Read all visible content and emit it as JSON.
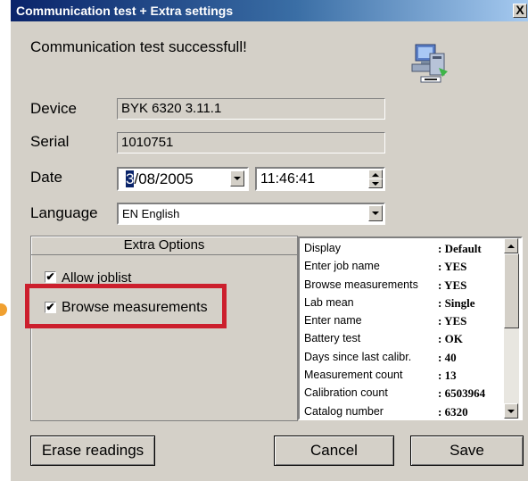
{
  "window": {
    "title": "Communication test + Extra settings",
    "close_label": "X"
  },
  "status_message": "Communication test successfull!",
  "fields": {
    "device": {
      "label": "Device",
      "value": "BYK 6320 3.11.1"
    },
    "serial": {
      "label": "Serial",
      "value": "1010751"
    },
    "date": {
      "label": "Date",
      "day_selected": "3",
      "date_rest": "/08/2005",
      "time": "11:46:41"
    },
    "language": {
      "label": "Language",
      "value": "EN English"
    }
  },
  "extra_options": {
    "title": "Extra Options",
    "allow_joblist": {
      "label": "Allow joblist",
      "checked": true
    },
    "browse_measurements": {
      "label": "Browse measurements",
      "checked": true
    }
  },
  "info_list": [
    {
      "key": "Display",
      "value": ": Default"
    },
    {
      "key": "Enter job name",
      "value": ": YES"
    },
    {
      "key": "Browse measurements",
      "value": ": YES"
    },
    {
      "key": "Lab mean",
      "value": ": Single"
    },
    {
      "key": "Enter name",
      "value": ": YES"
    },
    {
      "key": "Battery test",
      "value": ": OK"
    },
    {
      "key": "Days since last calibr.",
      "value": ": 40"
    },
    {
      "key": "Measurement count",
      "value": ": 13"
    },
    {
      "key": "Calibration count",
      "value": ": 6503964"
    },
    {
      "key": "Catalog number",
      "value": ": 6320"
    }
  ],
  "buttons": {
    "erase": "Erase readings",
    "cancel": "Cancel",
    "save": "Save"
  },
  "colors": {
    "dialog_bg": "#d4d0c8",
    "title_start": "#0a246a",
    "highlight": "#cc1f2d",
    "pointer": "#f0a030"
  },
  "icons": {
    "status": "network-computer-icon"
  }
}
